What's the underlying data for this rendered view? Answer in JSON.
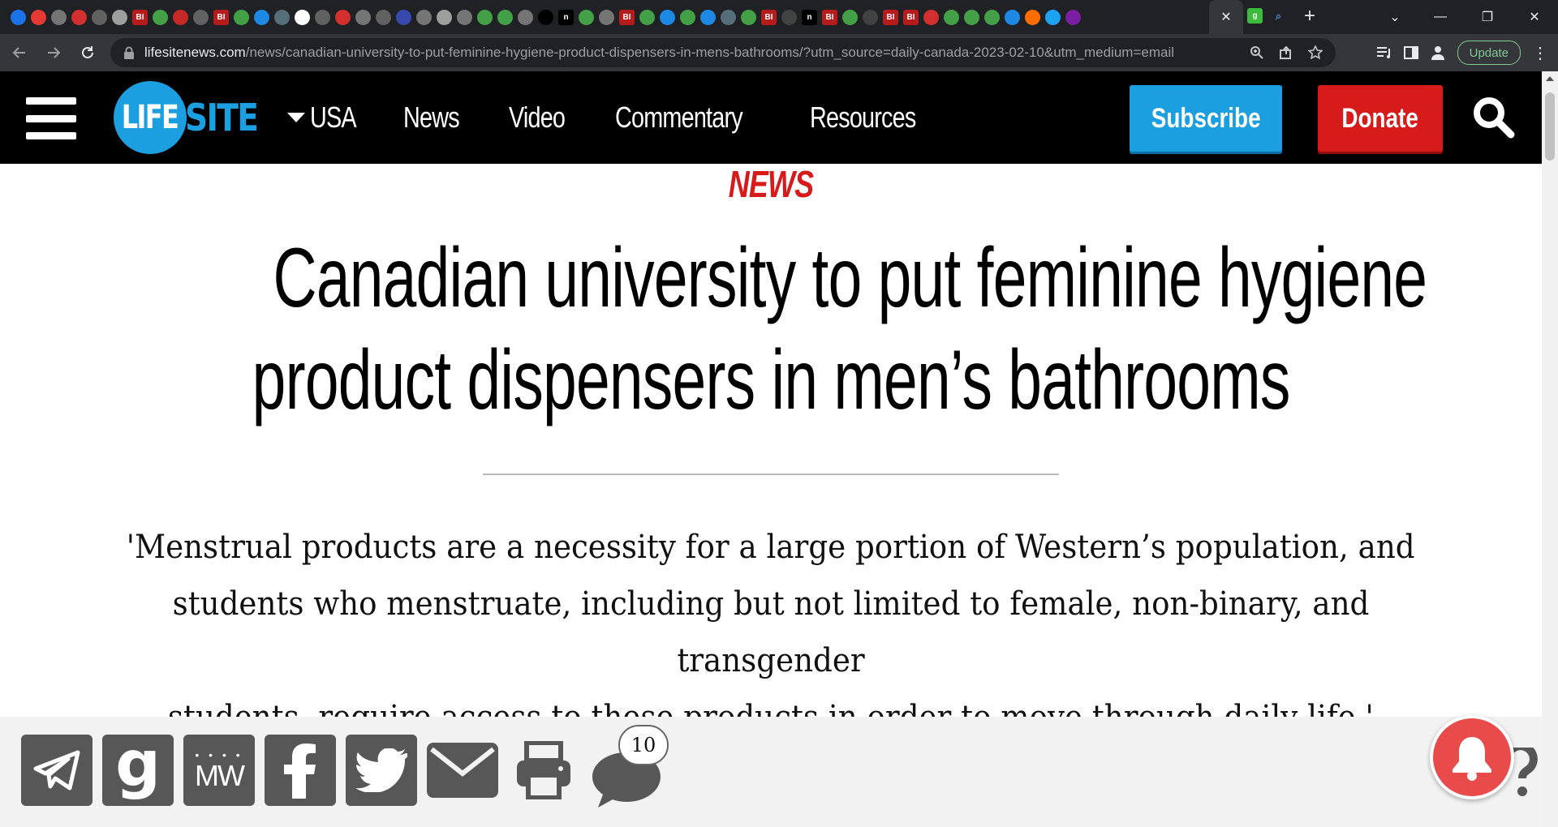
{
  "browser": {
    "active_tab_close": "✕",
    "new_tab": "+",
    "tab_dropdown": "⌄",
    "window_minimize": "—",
    "window_restore": "❐",
    "window_close": "✕",
    "url_domain": "lifesitenews.com",
    "url_path": "/news/canadian-university-to-put-feminine-hygiene-product-dispensers-in-mens-bathrooms/?utm_source=daily-canada-2023-02-10&utm_medium=email",
    "update_label": "Update",
    "favicon_labels": [
      "",
      "",
      "",
      "",
      "",
      "",
      "BI",
      "",
      "",
      "",
      "BI",
      "",
      "",
      "",
      "",
      "",
      "",
      "",
      "",
      "",
      "",
      "",
      "",
      "",
      "",
      "",
      "",
      "n",
      "",
      "",
      "BI",
      "",
      "",
      "",
      "",
      "",
      "",
      "BI",
      "",
      "n",
      "BI",
      "",
      "",
      "BI",
      "BI",
      "",
      "",
      "",
      "",
      "",
      "",
      "",
      "",
      "g",
      ""
    ]
  },
  "site": {
    "logo_life": "LIFE",
    "logo_site": "SITE",
    "nav": [
      "USA",
      "News",
      "Video",
      "Commentary",
      "Resources"
    ],
    "subscribe_label": "Subscribe",
    "donate_label": "Donate",
    "brand_blue": "#1c9fe0",
    "brand_red": "#d71a1a"
  },
  "article": {
    "kicker": "NEWS",
    "headline_line1": "Canadian university to put feminine hygiene",
    "headline_line2": "product dispensers in men’s bathrooms",
    "dek_line1": "'Menstrual products are a necessity for a large portion of Western’s population, and",
    "dek_line2": "students who menstruate, including but not limited to female, non-binary, and transgender",
    "dek_line3": "students, require access to these products in order to move through daily life.'"
  },
  "share": {
    "icons": [
      "telegram-icon",
      "gab-icon",
      "mewe-icon",
      "facebook-icon",
      "twitter-icon",
      "email-icon",
      "print-icon",
      "comment-icon"
    ],
    "gab_letter": "g",
    "mewe_text": "MW",
    "comment_count": "10"
  }
}
